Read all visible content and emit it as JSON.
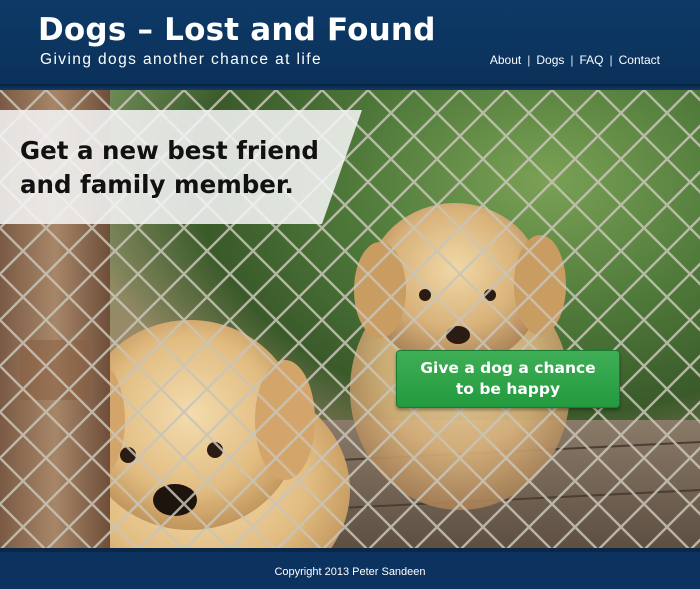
{
  "header": {
    "title": "Dogs – Lost and Found",
    "tagline": "Giving dogs another chance at life",
    "nav": [
      {
        "label": "About"
      },
      {
        "label": "Dogs"
      },
      {
        "label": "FAQ"
      },
      {
        "label": "Contact"
      }
    ],
    "nav_separator": "|"
  },
  "hero": {
    "headline_line1": "Get a new best friend",
    "headline_line2": "and family member.",
    "cta_line1": "Give a dog a chance",
    "cta_line2": "to be happy",
    "image_description": "puppies-behind-chain-link-fence-photo"
  },
  "footer": {
    "copyright": "Copyright 2013 Peter Sandeen"
  },
  "colors": {
    "header_bg": "#0e3a68",
    "cta_green": "#2aa347",
    "text_white": "#ffffff"
  }
}
